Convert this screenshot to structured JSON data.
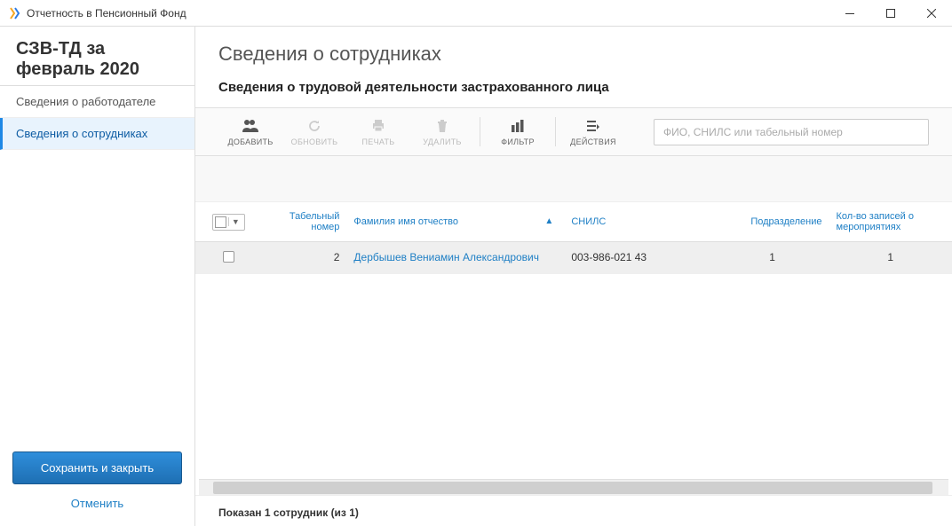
{
  "window": {
    "title": "Отчетность в Пенсионный Фонд"
  },
  "sidebar": {
    "header": "СЗВ-ТД за февраль 2020",
    "items": [
      {
        "label": "Сведения о работодателе",
        "active": false
      },
      {
        "label": "Сведения о сотрудниках",
        "active": true
      }
    ],
    "save_label": "Сохранить и закрыть",
    "cancel_label": "Отменить"
  },
  "main": {
    "title": "Сведения о сотрудниках",
    "subtitle": "Сведения о трудовой деятельности застрахованного лица"
  },
  "toolbar": {
    "add": "ДОБАВИТЬ",
    "refresh": "ОБНОВИТЬ",
    "print": "ПЕЧАТЬ",
    "delete": "УДАЛИТЬ",
    "filter": "ФИЛЬТР",
    "actions": "ДЕЙСТВИЯ",
    "search_placeholder": "ФИО, СНИЛС или табельный номер"
  },
  "table": {
    "columns": {
      "tab_no": "Табельный номер",
      "fio": "Фамилия имя отчество",
      "snils": "СНИЛС",
      "dept": "Подразделение",
      "events": "Кол-во записей о мероприятиях"
    },
    "rows": [
      {
        "tab_no": "2",
        "fio": "Дербышев Вениамин Александрович",
        "snils": "003-986-021 43",
        "dept": "1",
        "events": "1"
      }
    ]
  },
  "status": "Показан 1 сотрудник (из 1)"
}
